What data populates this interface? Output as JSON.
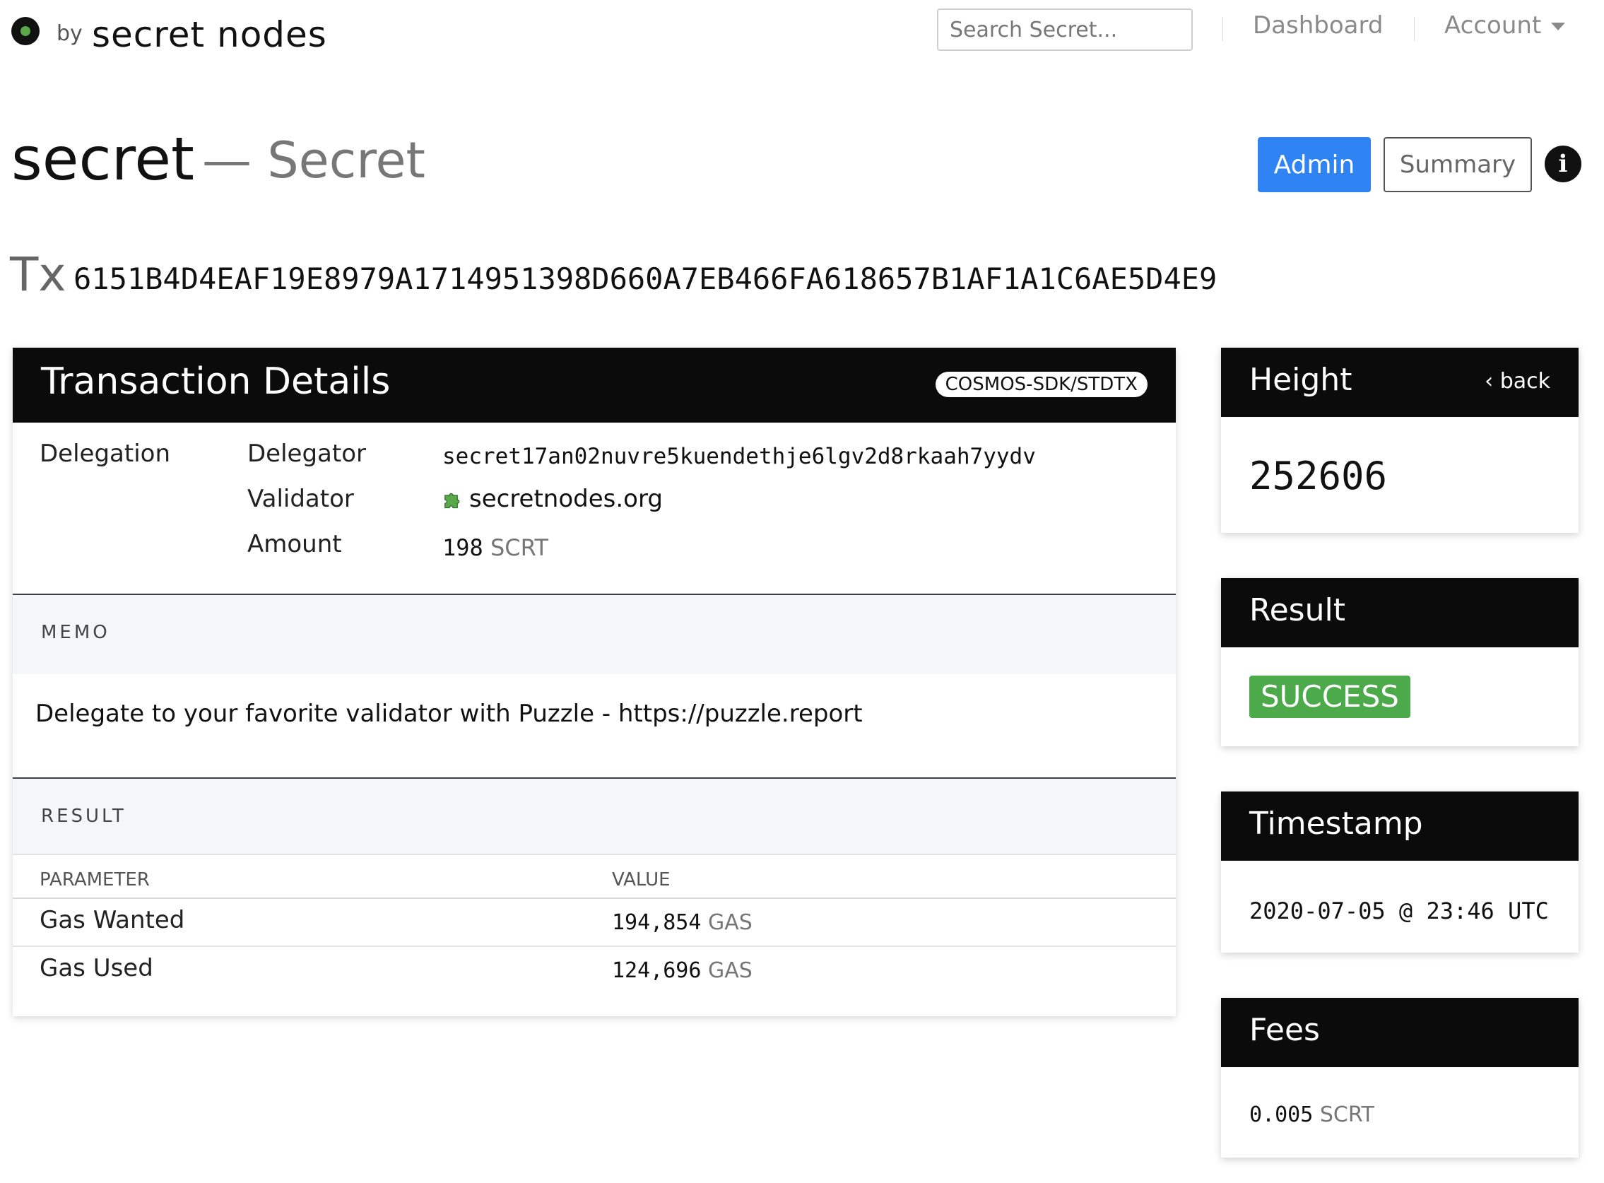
{
  "nav": {
    "by": "by",
    "brand": "secret nodes",
    "search_placeholder": "Search Secret...",
    "dashboard": "Dashboard",
    "account": "Account"
  },
  "page": {
    "title": "secret",
    "subtitle": "— Secret",
    "admin_button": "Admin",
    "summary_button": "Summary",
    "info_icon": "i"
  },
  "tx": {
    "label": "Tx",
    "hash": "6151B4D4EAF19E8979A1714951398D660A7EB466FA618657B1AF1A1C6AE5D4E9"
  },
  "details": {
    "title": "Transaction Details",
    "type_badge": "COSMOS-SDK/STDTX",
    "message_type": "Delegation",
    "fields": {
      "delegator_label": "Delegator",
      "delegator_value": "secret17an02nuvre5kuendethje6lgv2d8rkaah7yydv",
      "validator_label": "Validator",
      "validator_value": "secretnodes.org",
      "amount_label": "Amount",
      "amount_value": "198",
      "amount_unit": "SCRT"
    },
    "memo_heading": "MEMO",
    "memo_text": "Delegate to your favorite validator with Puzzle - https://puzzle.report",
    "result_heading": "RESULT",
    "result_table": {
      "headers": [
        "PARAMETER",
        "VALUE"
      ],
      "rows": [
        {
          "param": "Gas Wanted",
          "value": "194,854",
          "unit": "GAS"
        },
        {
          "param": "Gas Used",
          "value": "124,696",
          "unit": "GAS"
        }
      ]
    }
  },
  "side": {
    "height": {
      "title": "Height",
      "back": "back",
      "value": "252606"
    },
    "result": {
      "title": "Result",
      "status": "SUCCESS"
    },
    "timestamp": {
      "title": "Timestamp",
      "value": "2020-07-05 @ 23:46 UTC"
    },
    "fees": {
      "title": "Fees",
      "value": "0.005",
      "unit": "SCRT"
    }
  },
  "colors": {
    "accent": "#2f83f2",
    "success": "#4caa4a",
    "card_header": "#0b0b0b"
  },
  "icons": {
    "logo": "secret-nodes-logo-icon",
    "caret": "chevron-down-icon",
    "info": "info-icon",
    "validator": "puzzle-piece-icon",
    "back": "chevron-left-icon"
  }
}
